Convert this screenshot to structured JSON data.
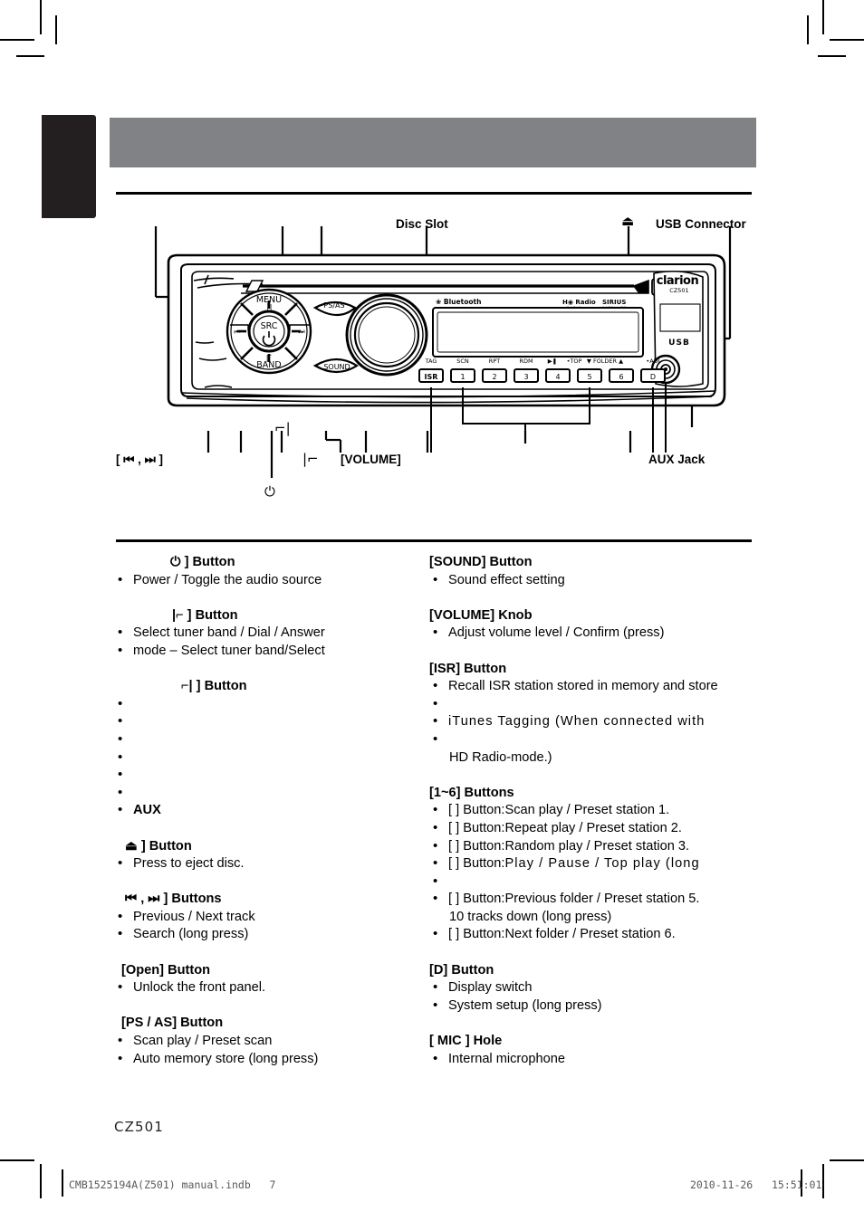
{
  "page": {
    "model_number": "CZ501",
    "header_title": ""
  },
  "diagram": {
    "callouts": {
      "hangup_icon": "⌐|",
      "disc_slot": "Disc Slot",
      "eject_icon": "⏏",
      "usb_connector": "USB Connector",
      "prev_next": "[ ⏮ , ⏭ ]",
      "answer_icon": "|⌐",
      "volume": "[VOLUME]",
      "aux_jack": "AUX Jack",
      "power_icon": "⏻"
    },
    "faceplate": {
      "menu": "MENU",
      "src": "SRC",
      "band": "BAND",
      "sound": "SOUND",
      "ps_as": "PS/AS",
      "bluetooth": "Bluetooth",
      "hd_radio": "HD Radio",
      "sirius": "SIRIUS",
      "brand": "clarion",
      "model": "CZ501",
      "usb": "USB",
      "isr": "ISR",
      "preset_labels": [
        "TAG",
        "SCN",
        "RPT",
        "RDM",
        "▶❙ •TOP",
        "▼ FOLDER ▲",
        "•ADJ"
      ],
      "preset_numbers": [
        "1",
        "2",
        "3",
        "4",
        "5",
        "6",
        "D"
      ]
    }
  },
  "left_column": {
    "groups": [
      {
        "heading": "⏻ ] Button",
        "heading_indent": "indent1",
        "items": [
          {
            "text": "Power / Toggle the audio source"
          }
        ]
      },
      {
        "heading": "|⌐ ] Button",
        "heading_indent": "indent2",
        "items": [
          {
            "text": "Select tuner band / Dial / Answer"
          },
          {
            "text": "mode – Select tuner band/Select",
            "indent": true
          }
        ]
      },
      {
        "heading": "⌐| ] Button",
        "heading_indent": "indent3",
        "items": [
          {
            "text": ""
          },
          {
            "text": ""
          },
          {
            "text": ""
          },
          {
            "text": ""
          },
          {
            "text": ""
          },
          {
            "text": ""
          },
          {
            "text": "AUX",
            "bold": true
          }
        ]
      },
      {
        "heading": "⏏ ] Button",
        "heading_indent": "indent5",
        "items": [
          {
            "text": "Press to eject disc."
          }
        ]
      },
      {
        "heading": "⏮ , ⏭ ] Buttons",
        "heading_indent": "indent5",
        "items": [
          {
            "text": "Previous / Next track"
          },
          {
            "text": "Search (long press)"
          }
        ]
      },
      {
        "heading": "[Open] Button",
        "heading_indent": "indent4",
        "items": [
          {
            "text": "Unlock the front panel."
          }
        ]
      },
      {
        "heading": "[PS / AS] Button",
        "heading_indent": "indent4",
        "items": [
          {
            "text": "Scan play / Preset scan"
          },
          {
            "text": "Auto memory store (long press)"
          }
        ]
      }
    ]
  },
  "right_column": {
    "groups": [
      {
        "heading": "[SOUND] Button",
        "items": [
          {
            "text": "Sound effect setting"
          }
        ]
      },
      {
        "heading": "[VOLUME] Knob",
        "items": [
          {
            "text": "Adjust volume level / Confirm (press)"
          }
        ]
      },
      {
        "heading": "[ISR] Button",
        "items": [
          {
            "text": "Recall ISR station stored in memory and store"
          },
          {
            "text": ""
          },
          {
            "text": "iTunes Tagging (When connected with",
            "tracked": true
          },
          {
            "text": ""
          },
          {
            "text": "HD Radio-mode.)",
            "nobullet": true
          }
        ]
      },
      {
        "heading": "[1~6] Buttons",
        "items": [
          {
            "label": "[  ] Button:",
            "text": "Scan play / Preset station 1."
          },
          {
            "label": "[  ] Button:",
            "text": "Repeat play / Preset station 2."
          },
          {
            "label": "[  ] Button:",
            "text": "Random play / Preset station 3."
          },
          {
            "label": "[  ] Button:",
            "text": "Play / Pause / Top play (long",
            "tracked": true
          },
          {
            "text": ""
          },
          {
            "label": "[  ] Button:",
            "text": "Previous folder / Preset station 5."
          },
          {
            "text": "10 tracks down (long press)",
            "nobullet": true,
            "deepindent": true
          },
          {
            "label": "[  ] Button:",
            "text": "Next folder / Preset station 6."
          }
        ]
      },
      {
        "heading": "[D] Button",
        "items": [
          {
            "text": "Display switch"
          },
          {
            "text": "System setup (long press)"
          }
        ]
      },
      {
        "heading": "[ MIC ] Hole",
        "items": [
          {
            "text": "Internal microphone"
          }
        ]
      }
    ]
  },
  "footer": {
    "file_line": "CMB1525194A(Z501) manual.indb   7",
    "timestamp": "2010-11-26   15:51:01"
  }
}
